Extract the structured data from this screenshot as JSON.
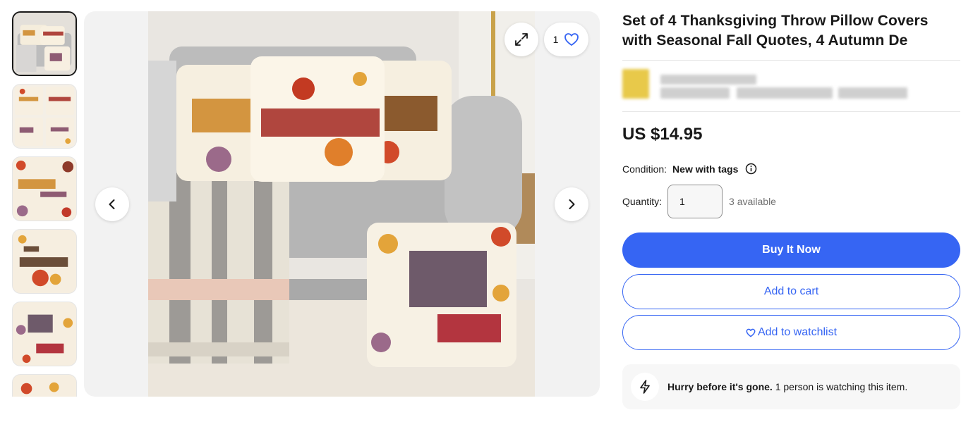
{
  "product": {
    "title": "Set of 4 Thanksgiving Throw Pillow Covers with Seasonal Fall Quotes, 4 Autumn De",
    "price": "US $14.95",
    "condition_label": "Condition:",
    "condition_value": "New with tags",
    "quantity_label": "Quantity:",
    "quantity_value": "1",
    "available": "3 available"
  },
  "gallery": {
    "watch_count": "1",
    "thumbnail_count": 6,
    "selected_index": 0
  },
  "actions": {
    "buy_now": "Buy It Now",
    "add_to_cart": "Add to cart",
    "add_to_watchlist": "Add to watchlist"
  },
  "urgency": {
    "headline": "Hurry before it's gone.",
    "detail": " 1 person is watching this item."
  },
  "icons": {
    "prev": "chevron-left-icon",
    "next": "chevron-right-icon",
    "expand": "expand-icon",
    "watch": "heart-icon",
    "info": "info-icon",
    "urgency": "lightning-icon"
  },
  "colors": {
    "accent": "#3665f3",
    "text": "#191919",
    "muted": "#707070",
    "panel": "#f2f2f2"
  }
}
